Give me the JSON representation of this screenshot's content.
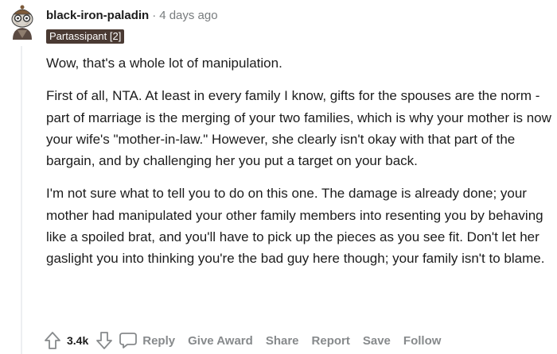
{
  "comment": {
    "username": "black-iron-paladin",
    "separator": "·",
    "time_ago": "4 days ago",
    "flair": "Partassipant [2]",
    "paragraphs": [
      "Wow, that's a whole lot of manipulation.",
      "First of all, NTA. At least in every family I know, gifts for the spouses are the norm - part of marriage is the merging of your two families, which is why your mother is now your wife's \"mother-in-law.\" However, she clearly isn't okay with that part of the bargain, and by challenging her you put a target on your back.",
      "I'm not sure what to tell you to do on this one. The damage is already done; your mother had manipulated your other family members into resenting you by behaving like a spoiled brat, and you'll have to pick up the pieces as you see fit. Don't let her gaslight you into thinking you're the bad guy here though; your family isn't to blame."
    ]
  },
  "actions": {
    "score": "3.4k",
    "reply": "Reply",
    "give_award": "Give Award",
    "share": "Share",
    "report": "Report",
    "save": "Save",
    "follow": "Follow"
  },
  "icons": {
    "avatar": "snoo-avatar-icon",
    "upvote": "upvote-arrow-icon",
    "downvote": "downvote-arrow-icon",
    "reply": "comment-bubble-icon"
  },
  "colors": {
    "flair_bg": "#4a3a33",
    "muted": "#878a8c",
    "text": "#1c1c1c"
  }
}
